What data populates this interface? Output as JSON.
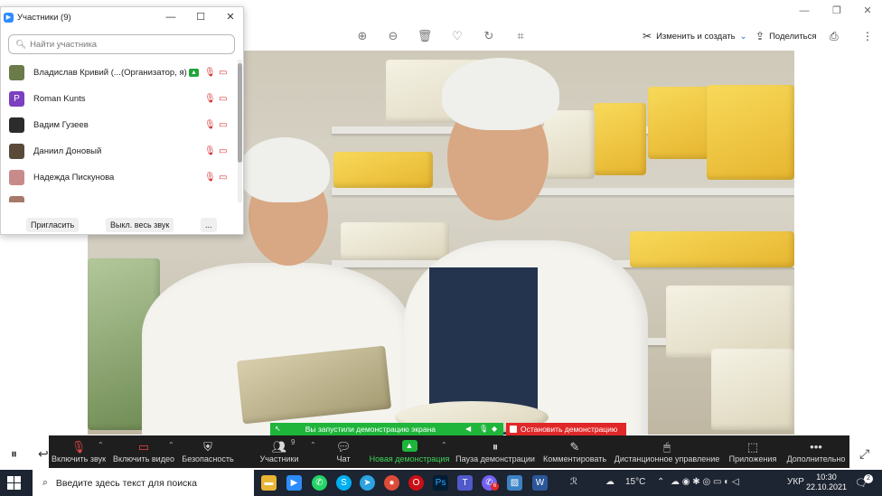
{
  "viewer": {
    "window_controls": [
      "—",
      "❐",
      "✕"
    ],
    "tools": [
      "zoom-in-icon",
      "zoom-out-icon",
      "delete-icon",
      "favorite-icon",
      "rotate-icon",
      "crop-icon"
    ],
    "edit_create_label": "Изменить и создать",
    "share_label": "Поделиться",
    "more_label": "⋮"
  },
  "participants": {
    "title": "Участники (9)",
    "search_placeholder": "Найти участника",
    "rows": [
      {
        "name": "Владислав Кривий (...",
        "role": "(Организатор, я)",
        "avatar_color": "#6b7b4a",
        "avatar_letter": ""
      },
      {
        "name": "Roman Kunts",
        "role": "",
        "avatar_color": "#7b3fbf",
        "avatar_letter": "P"
      },
      {
        "name": "Вадим Гузеев",
        "role": "",
        "avatar_color": "#2c2c2c",
        "avatar_letter": ""
      },
      {
        "name": "Даниил Доновый",
        "role": "",
        "avatar_color": "#5a4a3a",
        "avatar_letter": ""
      },
      {
        "name": "Надежда Пискунова",
        "role": "",
        "avatar_color": "#c98a8a",
        "avatar_letter": ""
      }
    ],
    "invite_label": "Пригласить",
    "mute_all_label": "Выкл. весь звук",
    "more_label": "..."
  },
  "share_banner": {
    "text": "Вы запустили демонстрацию экрана",
    "stop_label": "Остановить демонстрацию"
  },
  "meeting_toolbar": {
    "unmute": "Включить звук",
    "start_video": "Включить видео",
    "security": "Безопасность",
    "participants": "Участники",
    "participants_count": "9",
    "chat": "Чат",
    "new_share": "Новая демонстрация",
    "pause_share": "Пауза демонстрации",
    "annotate": "Комментировать",
    "remote_control": "Дистанционное управление",
    "apps": "Приложения",
    "more": "Дополнительно"
  },
  "taskbar": {
    "search_placeholder": "Введите здесь текст для поиска",
    "weather": "15°C",
    "language": "УКР",
    "time": "10:30",
    "date": "22.10.2021",
    "notification_count": "2",
    "app_badge": "6"
  },
  "colors": {
    "accent_blue": "#2d8cff",
    "share_green": "#1fb53b",
    "stop_red": "#e02828",
    "toolbar_bg": "#1e1e1e",
    "taskbar_bg": "#1d2432"
  }
}
